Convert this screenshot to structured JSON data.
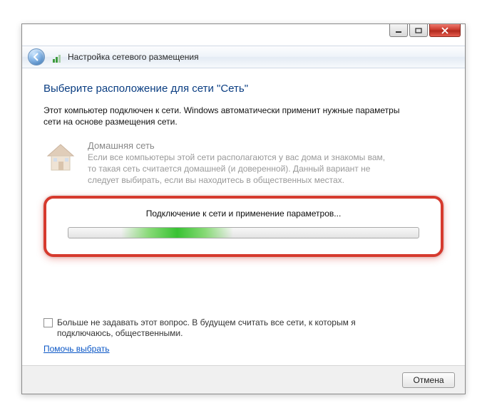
{
  "window": {
    "title": "Настройка сетевого размещения"
  },
  "content": {
    "heading": "Выберите расположение для сети \"Сеть\"",
    "description": "Этот компьютер подключен к сети. Windows автоматически применит нужные параметры сети на основе размещения сети.",
    "home_option": {
      "title": "Домашняя сеть",
      "text": "Если все компьютеры этой сети располагаются у вас дома и знакомы вам, то такая сеть считается домашней (и доверенной). Данный вариант не следует выбирать, если вы находитесь в общественных местах."
    },
    "progress_label": "Подключение к сети и применение параметров...",
    "dont_ask": "Больше не задавать этот вопрос. В будущем считать все сети, к которым я подключаюсь, общественными.",
    "help_link": "Помочь выбрать"
  },
  "footer": {
    "cancel": "Отмена"
  }
}
